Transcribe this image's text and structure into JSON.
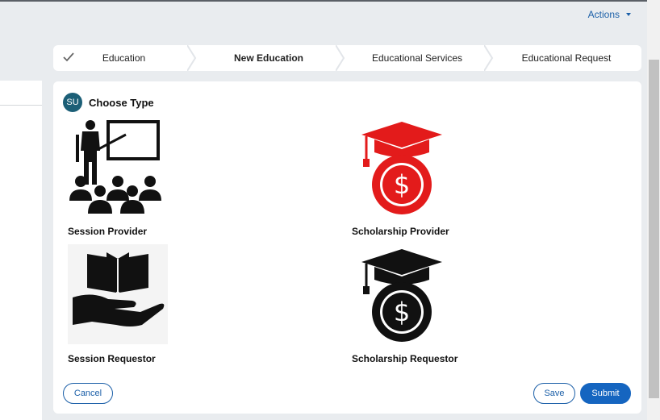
{
  "header": {
    "actions_label": "Actions"
  },
  "stepper": {
    "steps": [
      {
        "label": "Education",
        "state": "completed"
      },
      {
        "label": "New Education",
        "state": "current"
      },
      {
        "label": "Educational Services",
        "state": "upcoming"
      },
      {
        "label": "Educational Request",
        "state": "upcoming"
      }
    ]
  },
  "card": {
    "avatar_initials": "SU",
    "title": "Choose Type",
    "options": [
      {
        "label": "Session Provider",
        "icon": "teacher-classroom-icon"
      },
      {
        "label": "Scholarship Provider",
        "icon": "graduation-cap-dollar-red-icon"
      },
      {
        "label": "Session Requestor",
        "icon": "book-in-hand-icon"
      },
      {
        "label": "Scholarship Requestor",
        "icon": "graduation-cap-dollar-black-icon"
      }
    ]
  },
  "buttons": {
    "cancel": "Cancel",
    "save": "Save",
    "submit": "Submit"
  },
  "colors": {
    "accent": "#1565c0",
    "avatar": "#1c5f77",
    "scholarship_provider": "#e31b1b"
  }
}
